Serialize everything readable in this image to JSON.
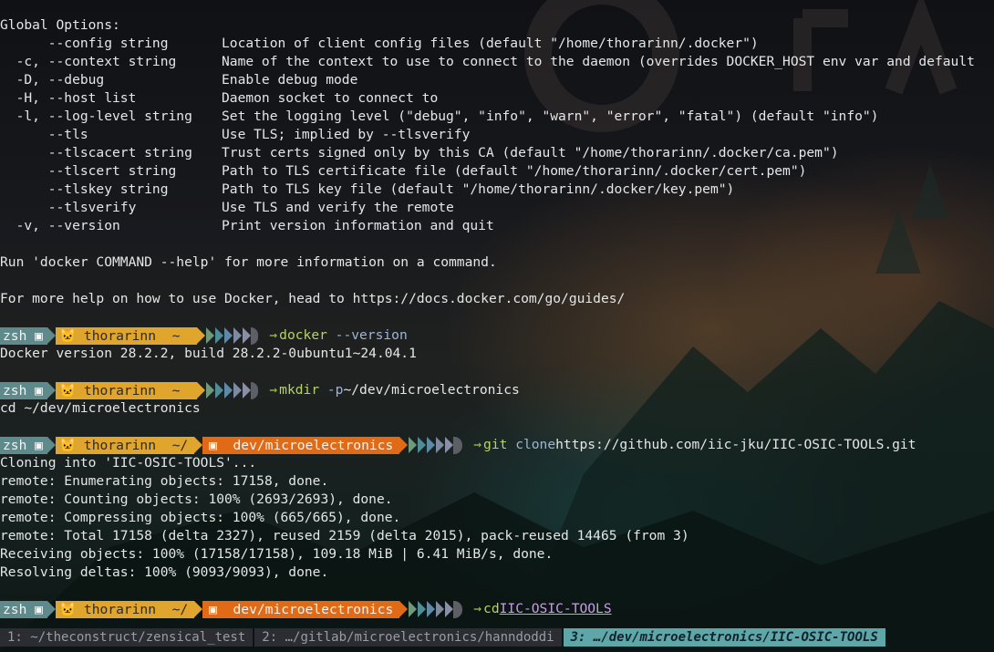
{
  "help": {
    "header": "Global Options:",
    "options": [
      {
        "flag": "      --config string",
        "desc": "Location of client config files (default \"/home/thorarinn/.docker\")"
      },
      {
        "flag": "  -c, --context string",
        "desc": "Name of the context to use to connect to the daemon (overrides DOCKER_HOST env var and default"
      },
      {
        "flag": "  -D, --debug",
        "desc": "Enable debug mode"
      },
      {
        "flag": "  -H, --host list",
        "desc": "Daemon socket to connect to"
      },
      {
        "flag": "  -l, --log-level string",
        "desc": "Set the logging level (\"debug\", \"info\", \"warn\", \"error\", \"fatal\") (default \"info\")"
      },
      {
        "flag": "      --tls",
        "desc": "Use TLS; implied by --tlsverify"
      },
      {
        "flag": "      --tlscacert string",
        "desc": "Trust certs signed only by this CA (default \"/home/thorarinn/.docker/ca.pem\")"
      },
      {
        "flag": "      --tlscert string",
        "desc": "Path to TLS certificate file (default \"/home/thorarinn/.docker/cert.pem\")"
      },
      {
        "flag": "      --tlskey string",
        "desc": "Path to TLS key file (default \"/home/thorarinn/.docker/key.pem\")"
      },
      {
        "flag": "      --tlsverify",
        "desc": "Use TLS and verify the remote"
      },
      {
        "flag": "  -v, --version",
        "desc": "Print version information and quit"
      }
    ],
    "run_hint": "Run 'docker COMMAND --help' for more information on a command.",
    "more_help": "For more help on how to use Docker, head to https://docs.docker.com/go/guides/"
  },
  "prompt": {
    "shell": "zsh",
    "user": "thorarinn",
    "home": "~",
    "dir_prefix": "~/",
    "dir": "dev/microelectronics",
    "arrow": "→"
  },
  "commands": [
    {
      "cmd": "docker",
      "flag": "--version",
      "arg": "",
      "output": [
        "Docker version 28.2.2, build 28.2.2-0ubuntu1~24.04.1"
      ]
    },
    {
      "cmd": "mkdir",
      "flag": "-p",
      "arg": "~/dev/microelectronics",
      "output": [
        "cd ~/dev/microelectronics"
      ]
    },
    {
      "cmd": "git",
      "flag": "clone",
      "arg": "https://github.com/iic-jku/IIC-OSIC-TOOLS.git",
      "output": [
        "Cloning into 'IIC-OSIC-TOOLS'...",
        "remote: Enumerating objects: 17158, done.",
        "remote: Counting objects: 100% (2693/2693), done.",
        "remote: Compressing objects: 100% (665/665), done.",
        "remote: Total 17158 (delta 2327), reused 2159 (delta 2015), pack-reused 14465 (from 3)",
        "Receiving objects: 100% (17158/17158), 109.18 MiB | 6.41 MiB/s, done.",
        "Resolving deltas: 100% (9093/9093), done."
      ]
    },
    {
      "cmd": "cd",
      "flag": "",
      "arg": "IIC-OSIC-TOOLS",
      "output": []
    }
  ],
  "tabs": [
    {
      "label": "1: ~/theconstruct/zensical_test",
      "active": false
    },
    {
      "label": "2: …/gitlab/microelectronics/hanndoddi",
      "active": false
    },
    {
      "label": "3: …/dev/microelectronics/IIC-OSIC-TOOLS",
      "active": true
    }
  ],
  "colors": {
    "prompt_shell": "#5f8a8c",
    "prompt_user": "#e0a52d",
    "prompt_dir": "#e06a16",
    "command": "#b6d463",
    "active_tab": "#5fa6a8"
  }
}
